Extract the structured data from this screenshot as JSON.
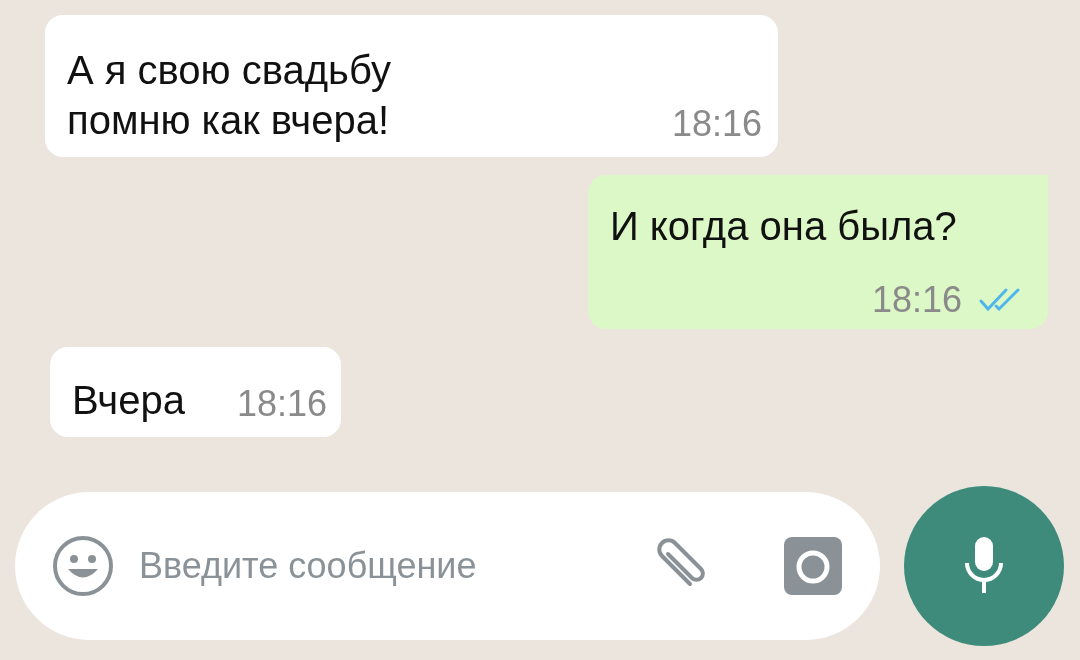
{
  "messages": [
    {
      "kind": "incoming",
      "text": "А я свою свадьбу\nпомню как вчера!",
      "time": "18:16"
    },
    {
      "kind": "outgoing",
      "text": "И когда она была?",
      "time": "18:16",
      "read": true
    },
    {
      "kind": "incoming",
      "text": "Вчера",
      "time": "18:16"
    }
  ],
  "composer": {
    "placeholder": "Введите сообщение"
  }
}
